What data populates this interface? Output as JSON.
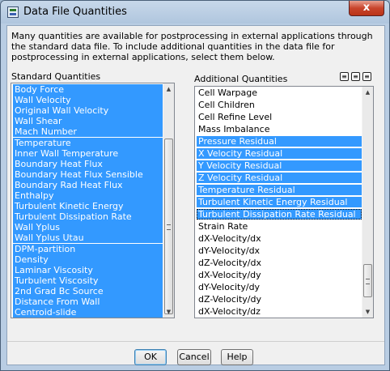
{
  "window": {
    "title": "Data File Quantities",
    "close_label": "x"
  },
  "description": "Many quantities are available for postprocessing in external applications through the standard data file. To include additional quantities in the data file for postprocessing in external applications, select them below.",
  "standard": {
    "label": "Standard Quantities",
    "items": [
      {
        "label": "Body Force",
        "selected": true
      },
      {
        "label": "Wall Velocity",
        "selected": true
      },
      {
        "label": "Original Wall Velocity",
        "selected": true
      },
      {
        "label": "Wall Shear",
        "selected": true
      },
      {
        "label": "Mach Number",
        "selected": true
      },
      {
        "label": "Temperature",
        "selected": true
      },
      {
        "label": "Inner Wall Temperature",
        "selected": true
      },
      {
        "label": "Boundary Heat Flux",
        "selected": true
      },
      {
        "label": "Boundary Heat Flux Sensible",
        "selected": true
      },
      {
        "label": "Boundary Rad Heat Flux",
        "selected": true
      },
      {
        "label": "Enthalpy",
        "selected": true
      },
      {
        "label": "Turbulent Kinetic Energy",
        "selected": true
      },
      {
        "label": "Turbulent Dissipation Rate",
        "selected": true
      },
      {
        "label": "Wall Yplus",
        "selected": true
      },
      {
        "label": "Wall Yplus Utau",
        "selected": true
      },
      {
        "label": "DPM-partition",
        "selected": true
      },
      {
        "label": "Density",
        "selected": true
      },
      {
        "label": "Laminar Viscosity",
        "selected": true
      },
      {
        "label": "Turbulent Viscosity",
        "selected": true
      },
      {
        "label": "2nd Grad Bc Source",
        "selected": true
      },
      {
        "label": "Distance From Wall",
        "selected": true
      },
      {
        "label": "Centroid-slide",
        "selected": true
      }
    ]
  },
  "additional": {
    "label": "Additional Quantities",
    "toolbar": [
      "select-all",
      "deselect-all",
      "invert-selection"
    ],
    "items": [
      {
        "label": "Cell Warpage",
        "selected": false
      },
      {
        "label": "Cell Children",
        "selected": false
      },
      {
        "label": "Cell Refine Level",
        "selected": false
      },
      {
        "label": "Mass Imbalance",
        "selected": false
      },
      {
        "label": "Pressure Residual",
        "selected": true
      },
      {
        "label": "X Velocity Residual",
        "selected": true
      },
      {
        "label": "Y Velocity Residual",
        "selected": true
      },
      {
        "label": "Z Velocity Residual",
        "selected": true
      },
      {
        "label": "Temperature Residual",
        "selected": true
      },
      {
        "label": "Turbulent Kinetic Energy Residual",
        "selected": true
      },
      {
        "label": "Turbulent Dissipation Rate Residual",
        "selected": true,
        "focused": true
      },
      {
        "label": "Strain Rate",
        "selected": false
      },
      {
        "label": "dX-Velocity/dx",
        "selected": false
      },
      {
        "label": "dY-Velocity/dx",
        "selected": false
      },
      {
        "label": "dZ-Velocity/dx",
        "selected": false
      },
      {
        "label": "dX-Velocity/dy",
        "selected": false
      },
      {
        "label": "dY-Velocity/dy",
        "selected": false
      },
      {
        "label": "dZ-Velocity/dy",
        "selected": false
      },
      {
        "label": "dX-Velocity/dz",
        "selected": false
      }
    ]
  },
  "buttons": {
    "ok": "OK",
    "cancel": "Cancel",
    "help": "Help"
  },
  "colors": {
    "selection": "#3399ff",
    "selection_text": "#ffffff"
  }
}
